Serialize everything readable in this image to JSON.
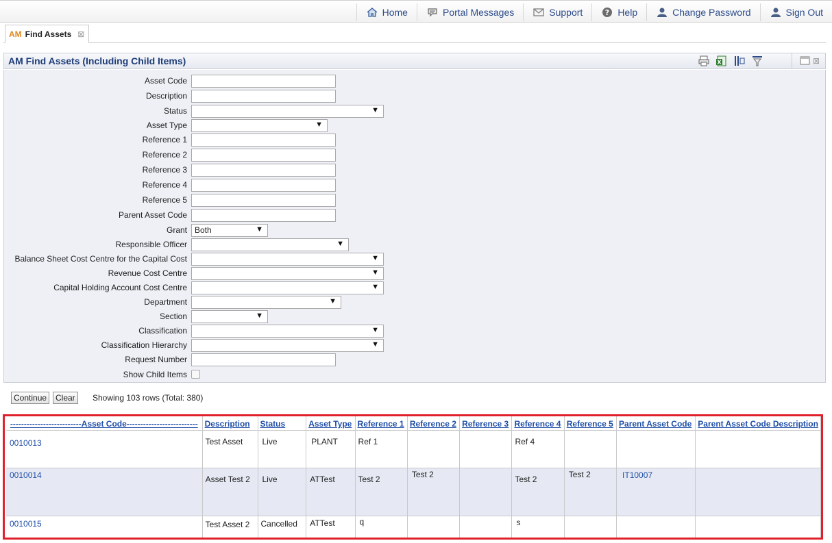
{
  "topnav": {
    "home": "Home",
    "messages": "Portal Messages",
    "support": "Support",
    "help": "Help",
    "change_password": "Change Password",
    "sign_out": "Sign Out"
  },
  "tab": {
    "prefix": "AM",
    "label": "Find Assets"
  },
  "panel": {
    "title": "AM Find Assets (Including Child Items)"
  },
  "form": {
    "asset_code": {
      "label": "Asset Code",
      "value": ""
    },
    "description": {
      "label": "Description",
      "value": ""
    },
    "status": {
      "label": "Status",
      "value": ""
    },
    "asset_type": {
      "label": "Asset Type",
      "value": ""
    },
    "reference1": {
      "label": "Reference 1",
      "value": ""
    },
    "reference2": {
      "label": "Reference 2",
      "value": ""
    },
    "reference3": {
      "label": "Reference 3",
      "value": ""
    },
    "reference4": {
      "label": "Reference 4",
      "value": ""
    },
    "reference5": {
      "label": "Reference 5",
      "value": ""
    },
    "parent_asset_code": {
      "label": "Parent Asset Code",
      "value": ""
    },
    "grant": {
      "label": "Grant",
      "value": "Both"
    },
    "responsible_officer": {
      "label": "Responsible Officer",
      "value": ""
    },
    "balance_sheet_cc": {
      "label": "Balance Sheet Cost Centre for the Capital Cost",
      "value": ""
    },
    "revenue_cc": {
      "label": "Revenue Cost Centre",
      "value": ""
    },
    "capital_holding_cc": {
      "label": "Capital Holding Account Cost Centre",
      "value": ""
    },
    "department": {
      "label": "Department",
      "value": ""
    },
    "section": {
      "label": "Section",
      "value": ""
    },
    "classification": {
      "label": "Classification",
      "value": ""
    },
    "classification_hierarchy": {
      "label": "Classification Hierarchy",
      "value": ""
    },
    "request_number": {
      "label": "Request Number",
      "value": ""
    },
    "show_child_items": {
      "label": "Show Child Items",
      "checked": false
    }
  },
  "buttons": {
    "continue": "Continue",
    "clear": "Clear"
  },
  "status_text": "Showing 103 rows (Total: 380)",
  "results": {
    "columns": [
      "--------------------------Asset Code--------------------------",
      "Description",
      "Status",
      "Asset Type",
      "Reference 1",
      "Reference 2",
      "Reference 3",
      "Reference 4",
      "Reference 5",
      "Parent Asset Code",
      "Parent Asset Code Description"
    ],
    "rows": [
      [
        "0010013",
        "Test Asset",
        "Live",
        "PLANT",
        "Ref 1",
        "",
        "",
        "Ref 4",
        "",
        "",
        ""
      ],
      [
        "0010014",
        "Asset Test 2",
        "Live",
        "ATTest",
        "Test 2",
        "Test 2",
        "",
        "Test 2",
        "Test 2",
        "IT10007",
        ""
      ],
      [
        "0010015",
        "Test Asset 2",
        "Cancelled",
        "ATTest",
        "q",
        "",
        "",
        "s",
        "",
        "",
        ""
      ]
    ]
  },
  "icons": {
    "home": "home-icon",
    "messages": "speech-bubble-icon",
    "support": "envelope-icon",
    "help": "question-icon",
    "change_password": "user-key-icon",
    "sign_out": "user-exit-icon",
    "print": "printer-icon",
    "excel": "excel-icon",
    "columns": "columns-icon",
    "filter": "filter-icon",
    "window": "window-icon",
    "close": "close-icon"
  },
  "colors": {
    "link": "#1f4fa8",
    "accent": "#e08a1e",
    "highlight": "#e0202a"
  }
}
